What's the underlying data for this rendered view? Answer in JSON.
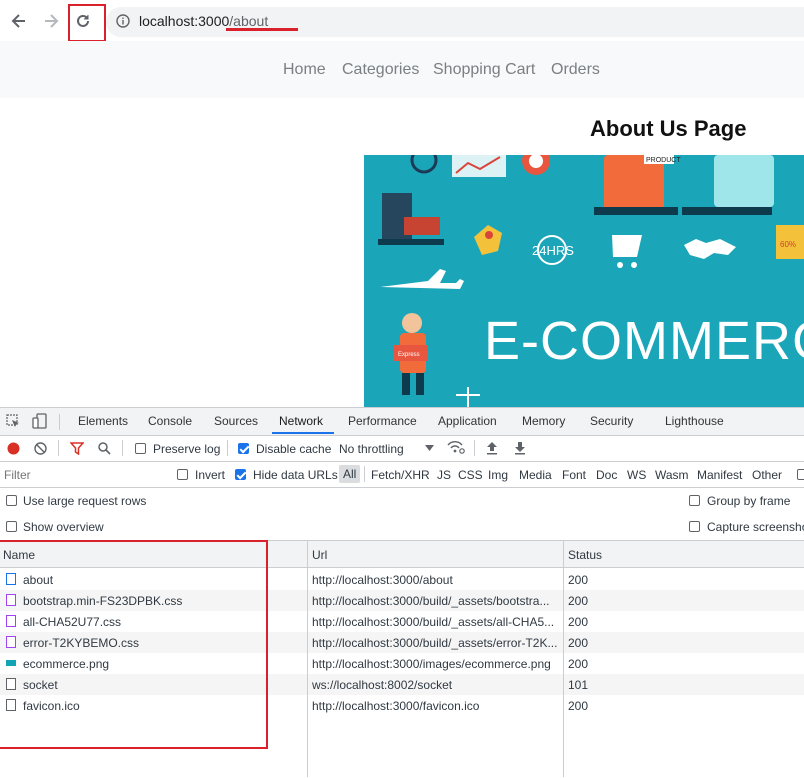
{
  "browser": {
    "url_host": "localhost:3000",
    "url_path": "/about"
  },
  "site": {
    "nav": [
      "Home",
      "Categories",
      "Shopping Cart",
      "Orders"
    ],
    "heading": "About Us Page",
    "hero_text": "E-COMMERC",
    "hero_badge": "24HRS",
    "hero_product": "PRODUCT",
    "hero_discount": "60%",
    "hero_express": "Express"
  },
  "devtools": {
    "tabs": [
      "Elements",
      "Console",
      "Sources",
      "Network",
      "Performance",
      "Application",
      "Memory",
      "Security",
      "Lighthouse"
    ],
    "active_tab": "Network",
    "toolbar": {
      "preserve_log": "Preserve log",
      "disable_cache": "Disable cache",
      "throttling": "No throttling"
    },
    "filter": {
      "placeholder": "Filter",
      "invert": "Invert",
      "hide_data_urls": "Hide data URLs",
      "types": [
        "All",
        "Fetch/XHR",
        "JS",
        "CSS",
        "Img",
        "Media",
        "Font",
        "Doc",
        "WS",
        "Wasm",
        "Manifest",
        "Other"
      ]
    },
    "options": {
      "large_rows": "Use large request rows",
      "show_overview": "Show overview",
      "group_by_frame": "Group by frame",
      "capture_screenshots": "Capture screenshots"
    },
    "columns": [
      "Name",
      "Url",
      "Status"
    ],
    "rows": [
      {
        "name": "about",
        "url": "http://localhost:3000/about",
        "status": "200",
        "icon": "document-icon"
      },
      {
        "name": "bootstrap.min-FS23DPBK.css",
        "url": "http://localhost:3000/build/_assets/bootstra...",
        "status": "200",
        "icon": "stylesheet-icon"
      },
      {
        "name": "all-CHA52U77.css",
        "url": "http://localhost:3000/build/_assets/all-CHA5...",
        "status": "200",
        "icon": "stylesheet-icon"
      },
      {
        "name": "error-T2KYBEMO.css",
        "url": "http://localhost:3000/build/_assets/error-T2K...",
        "status": "200",
        "icon": "stylesheet-icon"
      },
      {
        "name": "ecommerce.png",
        "url": "http://localhost:3000/images/ecommerce.png",
        "status": "200",
        "icon": "image-icon"
      },
      {
        "name": "socket",
        "url": "ws://localhost:8002/socket",
        "status": "101",
        "icon": "websocket-icon"
      },
      {
        "name": "favicon.ico",
        "url": "http://localhost:3000/favicon.ico",
        "status": "200",
        "icon": "file-icon"
      }
    ]
  },
  "colors": {
    "annotation_red": "#d9202b",
    "devtools_blue": "#1a73e8",
    "hero_teal": "#1aa6b8",
    "record_red": "#d93025"
  }
}
